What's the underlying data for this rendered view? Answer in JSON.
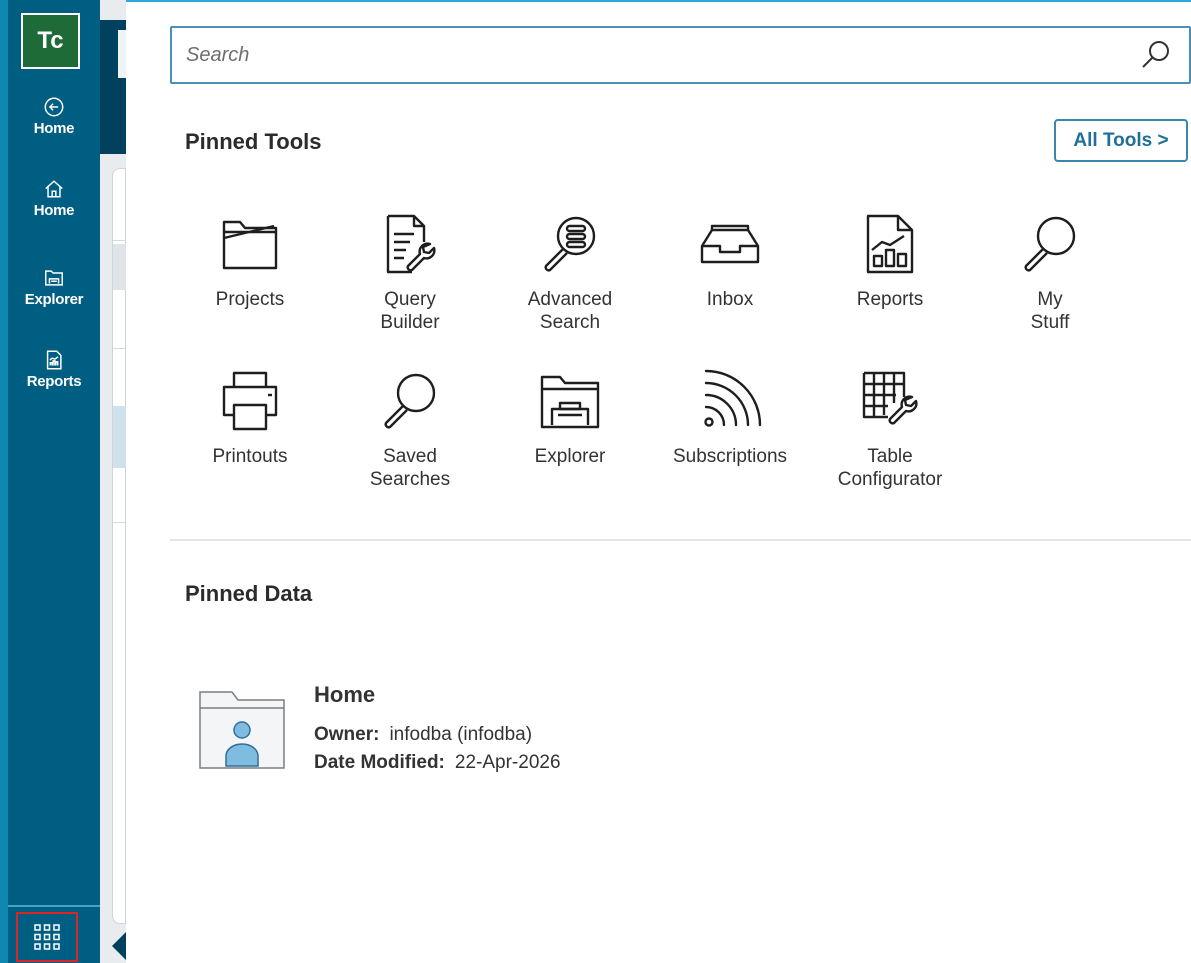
{
  "rail": {
    "logo": "Tc",
    "items": [
      {
        "label": "Home",
        "icon": "back-circle-icon"
      },
      {
        "label": "Home",
        "icon": "home-icon"
      },
      {
        "label": "Explorer",
        "icon": "explorer-icon"
      },
      {
        "label": "Reports",
        "icon": "reports-icon"
      }
    ],
    "apps_icon": "grid-icon"
  },
  "search": {
    "placeholder": "Search",
    "value": ""
  },
  "pinned_tools": {
    "title": "Pinned Tools",
    "all_tools_label": "All Tools >",
    "tools": [
      {
        "label": "Projects",
        "icon": "projects-folder-icon"
      },
      {
        "label": "Query\nBuilder",
        "icon": "query-builder-icon"
      },
      {
        "label": "Advanced\nSearch",
        "icon": "advanced-search-icon"
      },
      {
        "label": "Inbox",
        "icon": "inbox-icon"
      },
      {
        "label": "Reports",
        "icon": "reports-icon"
      },
      {
        "label": "My\nStuff",
        "icon": "magnifier-icon"
      },
      {
        "label": "Printouts",
        "icon": "printer-icon"
      },
      {
        "label": "Saved\nSearches",
        "icon": "magnifier-icon"
      },
      {
        "label": "Explorer",
        "icon": "explorer-folder-icon"
      },
      {
        "label": "Subscriptions",
        "icon": "subscriptions-icon"
      },
      {
        "label": "Table\nConfigurator",
        "icon": "table-configurator-icon"
      }
    ]
  },
  "pinned_data": {
    "title": "Pinned Data",
    "items": [
      {
        "name": "Home",
        "owner_label": "Owner:",
        "owner": "infodba (infodba)",
        "modified_label": "Date Modified:",
        "modified": "22-Apr-2026",
        "icon": "home-folder-user-icon"
      }
    ]
  },
  "colors": {
    "rail": "#005e82",
    "rail_accent": "#0f87b0",
    "logo_bg": "#1e6b37",
    "link": "#1f6f98",
    "highlight": "#e02424"
  }
}
